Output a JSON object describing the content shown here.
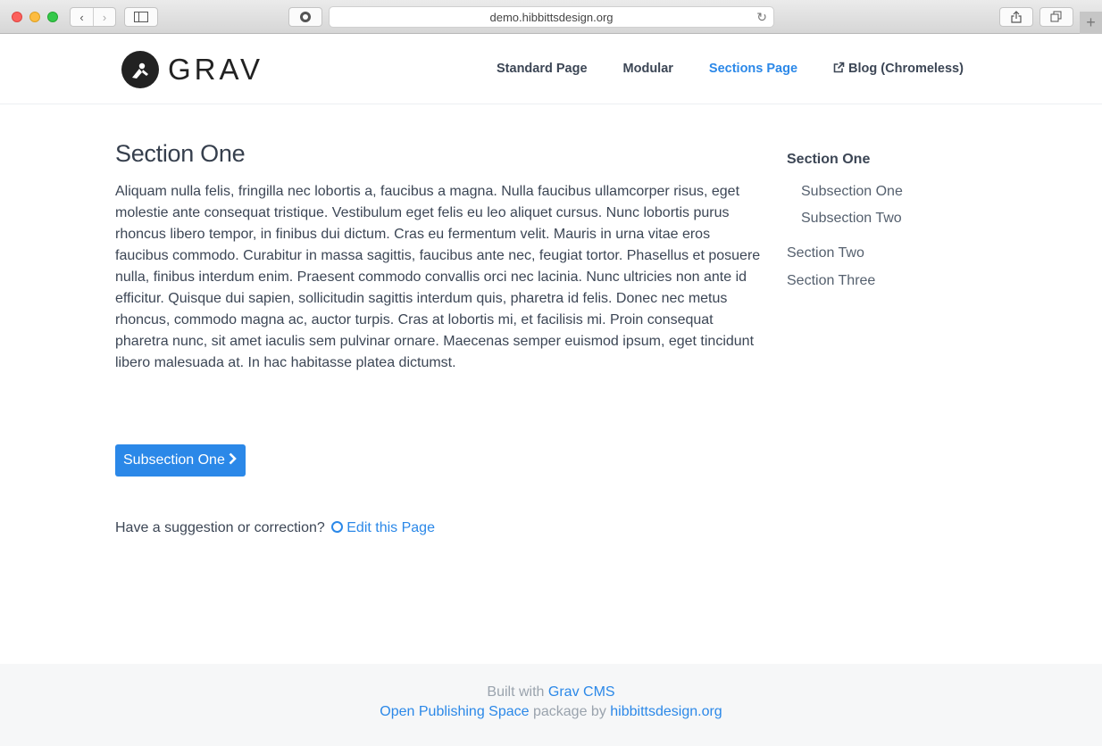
{
  "browser": {
    "url": "demo.hibbittsdesign.org",
    "back_icon": "‹",
    "forward_icon": "›",
    "newtab_icon": "+"
  },
  "site": {
    "logo_text": "GRAV",
    "nav": [
      {
        "label": "Standard Page"
      },
      {
        "label": "Modular"
      },
      {
        "label": "Sections Page"
      },
      {
        "label": "Blog (Chromeless)"
      }
    ]
  },
  "main": {
    "title": "Section One",
    "body": "Aliquam nulla felis, fringilla nec lobortis a, faucibus a magna. Nulla faucibus ullamcorper risus, eget molestie ante consequat tristique. Vestibulum eget felis eu leo aliquet cursus. Nunc lobortis purus rhoncus libero tempor, in finibus dui dictum. Cras eu fermentum velit. Mauris in urna vitae eros faucibus commodo. Curabitur in massa sagittis, faucibus ante nec, feugiat tortor. Phasellus et posuere nulla, finibus interdum enim. Praesent commodo convallis orci nec lacinia. Nunc ultricies non ante id efficitur. Quisque dui sapien, sollicitudin sagittis interdum quis, pharetra id felis. Donec nec metus rhoncus, commodo magna ac, auctor turpis. Cras at lobortis mi, et facilisis mi. Proin consequat pharetra nunc, sit amet iaculis sem pulvinar ornare. Maecenas semper euismod ipsum, eget tincidunt libero malesuada at. In hac habitasse platea dictumst.",
    "next_button": "Subsection One",
    "suggestion_text": "Have a suggestion or correction?",
    "edit_link": "Edit this Page"
  },
  "toc": {
    "heading": "Section One",
    "subs": [
      "Subsection One",
      "Subsection Two"
    ],
    "items": [
      "Section Two",
      "Section Three"
    ]
  },
  "footer": {
    "built_with": "Built with",
    "grav_cms": "Grav CMS",
    "ops": "Open Publishing Space",
    "package_by": "package by",
    "hibbitts": "hibbittsdesign.org"
  },
  "colors": {
    "accent": "#2b88e8",
    "text": "#3c4655",
    "footer_bg": "#f6f7f8"
  }
}
